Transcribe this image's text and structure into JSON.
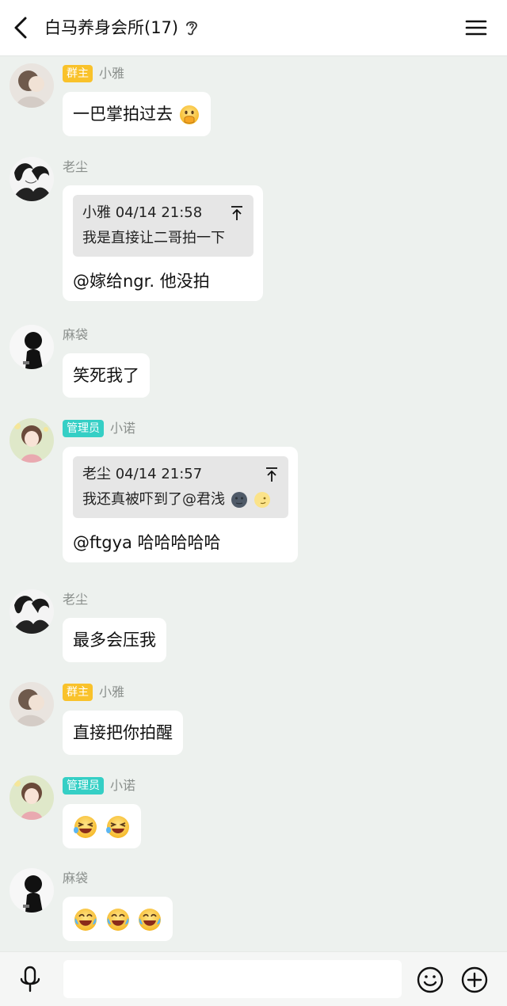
{
  "header": {
    "title": "白马养身会所(17)",
    "back_icon": "chevron-left-icon",
    "ear_icon": "ear-icon",
    "menu_icon": "menu-icon"
  },
  "messages": [
    {
      "sender": "小雅",
      "badge": "群主",
      "text": "一巴掌拍过去",
      "emoji": [
        "face-with-hand-over-mouth"
      ]
    },
    {
      "sender": "老尘",
      "quote": {
        "meta": "小雅 04/14 21:58",
        "text": "我是直接让二哥拍一下"
      },
      "text": "@嫁给ngr. 他没拍"
    },
    {
      "sender": "麻袋",
      "text": "笑死我了"
    },
    {
      "sender": "小诺",
      "badge": "管理员",
      "quote": {
        "meta": "老尘 04/14 21:57",
        "text": "我还真被吓到了@君浅",
        "emoji": [
          "new-moon-face",
          "crescent-moon-face"
        ]
      },
      "text": "@ftgya 哈哈哈哈哈"
    },
    {
      "sender": "老尘",
      "text": "最多会压我"
    },
    {
      "sender": "小雅",
      "badge": "群主",
      "text": "直接把你拍醒"
    },
    {
      "sender": "小诺",
      "badge": "管理员",
      "emoji": [
        "laughing-squint-face",
        "laughing-squint-face"
      ]
    },
    {
      "sender": "麻袋",
      "emoji": [
        "tears-of-joy-face",
        "tears-of-joy-face",
        "tears-of-joy-face"
      ]
    }
  ],
  "input_bar": {
    "message_value": "",
    "mic_icon": "microphone-icon",
    "emoji_icon": "smiley-icon",
    "plus_icon": "plus-circle-icon"
  },
  "colors": {
    "background": "#edf1ee",
    "owner_badge": "#f9c22b",
    "admin_badge": "#35cfc5"
  }
}
